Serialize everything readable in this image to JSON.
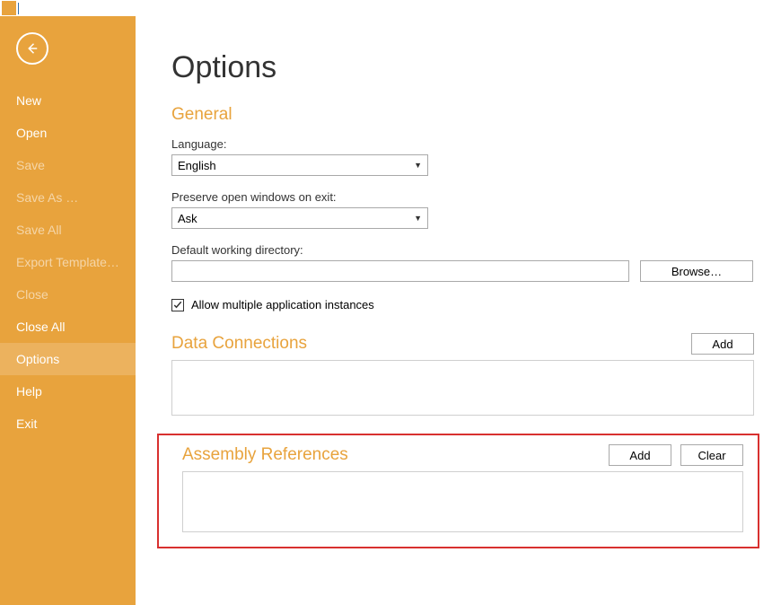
{
  "titlebar": {
    "icon_label": ""
  },
  "sidebar": {
    "items": [
      {
        "label": "New",
        "disabled": false,
        "selected": false
      },
      {
        "label": "Open",
        "disabled": false,
        "selected": false
      },
      {
        "label": "Save",
        "disabled": true,
        "selected": false
      },
      {
        "label": "Save As …",
        "disabled": true,
        "selected": false
      },
      {
        "label": "Save All",
        "disabled": true,
        "selected": false
      },
      {
        "label": "Export Template…",
        "disabled": true,
        "selected": false
      },
      {
        "label": "Close",
        "disabled": true,
        "selected": false
      },
      {
        "label": "Close All",
        "disabled": false,
        "selected": false
      },
      {
        "label": "Options",
        "disabled": false,
        "selected": true
      },
      {
        "label": "Help",
        "disabled": false,
        "selected": false
      },
      {
        "label": "Exit",
        "disabled": false,
        "selected": false
      }
    ]
  },
  "page": {
    "title": "Options"
  },
  "general": {
    "section_title": "General",
    "language_label": "Language:",
    "language_value": "English",
    "preserve_label": "Preserve open windows on exit:",
    "preserve_value": "Ask",
    "working_dir_label": "Default working directory:",
    "working_dir_value": "",
    "browse_label": "Browse…",
    "allow_multi_label": "Allow multiple application instances",
    "allow_multi_checked": true
  },
  "data_connections": {
    "section_title": "Data Connections",
    "add_label": "Add"
  },
  "assembly": {
    "section_title": "Assembly References",
    "add_label": "Add",
    "clear_label": "Clear"
  }
}
